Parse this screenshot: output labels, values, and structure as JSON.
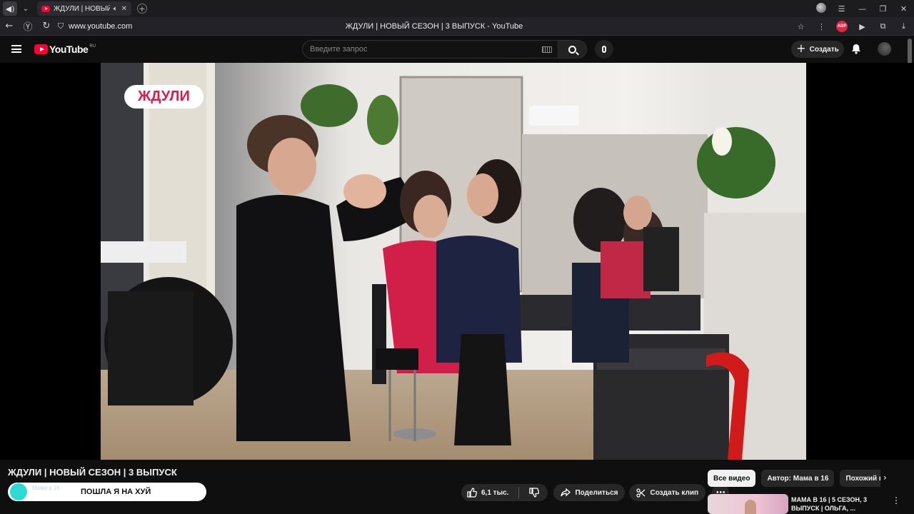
{
  "browser": {
    "tab_title": "ЖДУЛИ | НОВЫЙ СЕЗОН | 3 ВЫПУСК - YouTube",
    "tab_title_display": "ЖДУЛИ | НОВЫЙ СЕ",
    "url": "www.youtube.com",
    "page_title": "ЖДУЛИ | НОВЫЙ СЕЗОН | 3 ВЫПУСК - YouTube",
    "abp_label": "ABP"
  },
  "youtube": {
    "logo_text": "YouTube",
    "region": "RU",
    "search_placeholder": "Введите запрос",
    "create_label": "Создать"
  },
  "video": {
    "watermark": "ЖДУЛИ",
    "title": "ЖДУЛИ | НОВЫЙ СЕЗОН | 3 ВЫПУСК",
    "channel_overlay_text": "ПОШЛА Я НА ХУЙ",
    "channel_faint_text": "Мама в 16"
  },
  "actions": {
    "likes": "6,1 тыс.",
    "share": "Поделиться",
    "clip": "Создать клип"
  },
  "chips": [
    "Все видео",
    "Автор: Мама в 16",
    "Похожий контент"
  ],
  "recommendation": {
    "title": "МАМА В 16 | 5 СЕЗОН, 3 ВЫПУСК | ОЛЬГА, ..."
  }
}
